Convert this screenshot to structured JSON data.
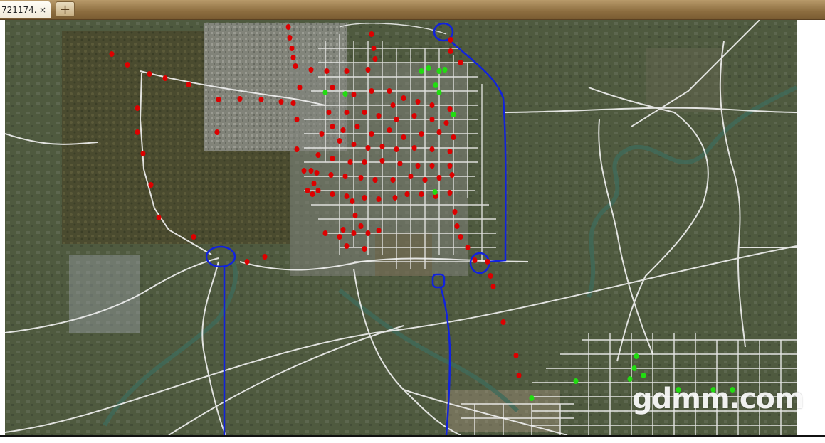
{
  "browser": {
    "tab_title": "721174...",
    "tab_close": "×",
    "new_tab": "+"
  },
  "map": {
    "watermark": "gdmm.com",
    "colors": {
      "roads": "#f2f2f2",
      "red_marker": "#dd0000",
      "green_marker": "#22dd11",
      "route_line": "#1122dd"
    }
  }
}
